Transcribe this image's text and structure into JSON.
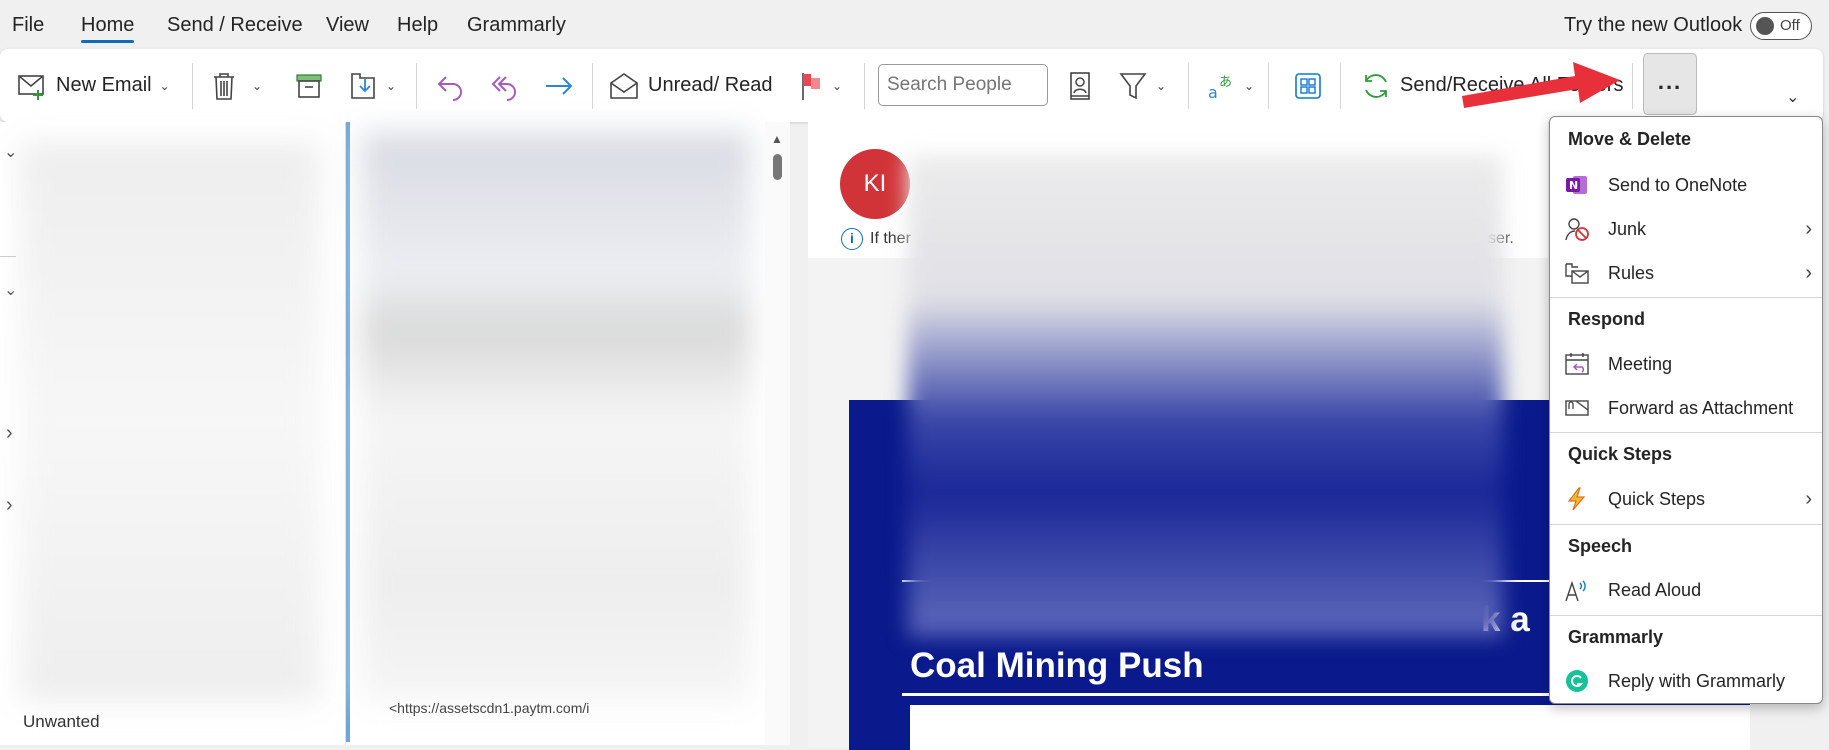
{
  "menubar": {
    "tabs": [
      "File",
      "Home",
      "Send / Receive",
      "View",
      "Help",
      "Grammarly"
    ],
    "active": "Home",
    "try_new_outlook": "Try the new Outlook",
    "toggle_state": "Off"
  },
  "ribbon": {
    "new_email": "New Email",
    "unread_read": "Unread/ Read",
    "search_people_placeholder": "Search People",
    "send_receive": "Send/Receive All Folders",
    "more_label": "...",
    "accent": "#0f6cbd"
  },
  "folders": {
    "visible_item": "Unwanted"
  },
  "list": {
    "visible_text": "<https://assetscdn1.paytm.com/i"
  },
  "reading": {
    "avatar_initials": "KI",
    "avatar_color": "#d13438",
    "info_prefix": "If ther",
    "info_suffix": "ser.",
    "banner_headline": "Coal Mining Push",
    "banner_fragment": "k a",
    "banner_color": "#0a1a8c"
  },
  "menu": {
    "sections": [
      {
        "title": "Move & Delete",
        "items": [
          {
            "label": "Send to OneNote",
            "icon": "onenote-icon"
          },
          {
            "label": "Junk",
            "icon": "junk-icon",
            "submenu": true
          },
          {
            "label": "Rules",
            "icon": "rules-icon",
            "submenu": true
          }
        ]
      },
      {
        "title": "Respond",
        "items": [
          {
            "label": "Meeting",
            "icon": "meeting-icon"
          },
          {
            "label": "Forward as Attachment",
            "icon": "forward-attachment-icon"
          }
        ]
      },
      {
        "title": "Quick Steps",
        "items": [
          {
            "label": "Quick Steps",
            "icon": "lightning-icon",
            "submenu": true
          }
        ]
      },
      {
        "title": "Speech",
        "items": [
          {
            "label": "Read Aloud",
            "icon": "read-aloud-icon"
          }
        ]
      },
      {
        "title": "Grammarly",
        "items": [
          {
            "label": "Reply with Grammarly",
            "icon": "grammarly-icon"
          }
        ]
      }
    ]
  },
  "annotation_color": "#e8303a"
}
